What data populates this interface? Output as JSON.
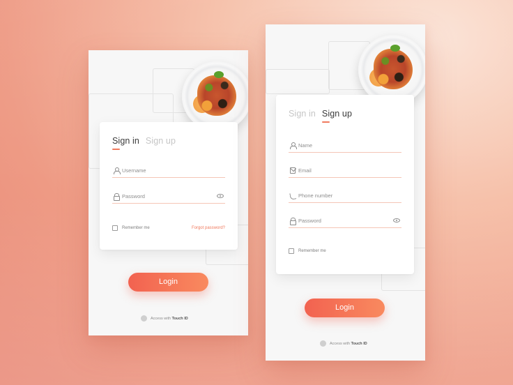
{
  "left_screen": {
    "tabs": [
      {
        "label": "Sign in",
        "active": true
      },
      {
        "label": "Sign up",
        "active": false
      }
    ],
    "fields": [
      {
        "placeholder": "Username",
        "icon": "user-icon"
      },
      {
        "placeholder": "Password",
        "icon": "lock-icon",
        "trailing_icon": "eye-icon"
      }
    ],
    "remember_label": "Remember me",
    "forgot_label": "Forgot password?",
    "login_label": "Login",
    "touch_prefix": "Access with",
    "touch_bold": "Touch ID"
  },
  "right_screen": {
    "tabs": [
      {
        "label": "Sign in",
        "active": false
      },
      {
        "label": "Sign up",
        "active": true
      }
    ],
    "fields": [
      {
        "placeholder": "Name",
        "icon": "user-icon"
      },
      {
        "placeholder": "Email",
        "icon": "mail-icon"
      },
      {
        "placeholder": "Phone number",
        "icon": "phone-icon"
      },
      {
        "placeholder": "Password",
        "icon": "lock-icon",
        "trailing_icon": "eye-icon"
      }
    ],
    "remember_label": "Remember me",
    "login_label": "Login",
    "touch_prefix": "Access with",
    "touch_bold": "Touch ID"
  },
  "colors": {
    "accent": "#f07a5e",
    "button_start": "#f26250",
    "button_end": "#f98a5f",
    "background_light": "#fbe3d6",
    "background_dark": "#e98a78"
  }
}
